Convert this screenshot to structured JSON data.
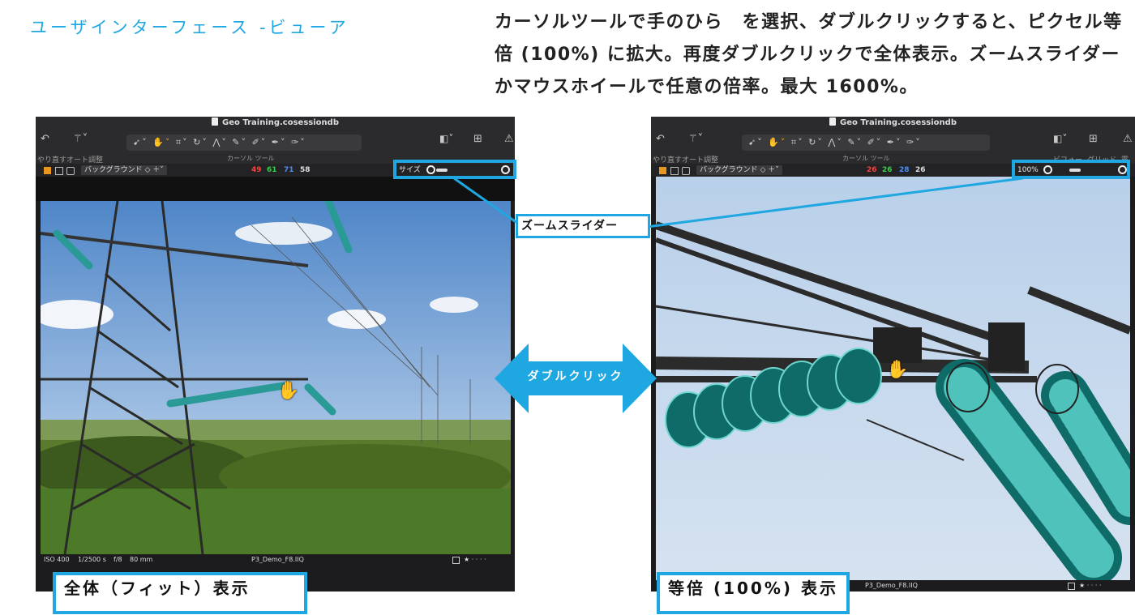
{
  "slide": {
    "title": "ユーザインターフェース -ビューア",
    "description": "カーソルツールで手のひら　を選択、ダブルクリックすると、ピクセル等倍 (100%) に拡大。再度ダブルクリックで全体表示。ズームスライダーかマウスホイールで任意の倍率。最大 1600%。"
  },
  "app": {
    "window_title": "Geo Training.cosessiondb",
    "toolbar": {
      "undo_label": "やり直す",
      "auto_adjust_label": "オート調整",
      "cursor_tools_label": "カーソル ツール",
      "before_label": "ビフォー",
      "grid_label": "グリッド",
      "exposure_label": "露出"
    },
    "subbar": {
      "background_select": "バックグラウンド"
    },
    "icons": [
      "undo-icon",
      "magic-wand-icon",
      "select-icon",
      "hand-icon",
      "crop-icon",
      "rotate-icon",
      "keystone-icon",
      "brush-icon",
      "grid-icon",
      "warning-icon",
      "zoom-icon"
    ]
  },
  "left_view": {
    "rgb": [
      "49",
      "61",
      "71",
      "58"
    ],
    "zoom_text": "サイズ",
    "status": {
      "iso": "ISO 400",
      "shutter": "1/2500 s",
      "aperture": "f/8",
      "focal": "80 mm",
      "filename": "P3_Demo_F8.IIQ",
      "rating": "★ · · · ·"
    },
    "caption": "全体（フィット）表示"
  },
  "right_view": {
    "rgb": [
      "26",
      "26",
      "28",
      "26"
    ],
    "zoom_text": "100%",
    "status": {
      "filename": "P3_Demo_F8.IIQ",
      "rating": "★ · · · ·"
    },
    "caption": "等倍 (100%) 表示"
  },
  "annotations": {
    "zoom_slider_label": "ズームスライダー",
    "double_click_label": "ダブルクリック"
  },
  "colors": {
    "accent": "#1ea7e0",
    "app_bg": "#1c1c1e",
    "red": "#ff4040",
    "green": "#36d04a",
    "blue": "#4a8cff"
  }
}
